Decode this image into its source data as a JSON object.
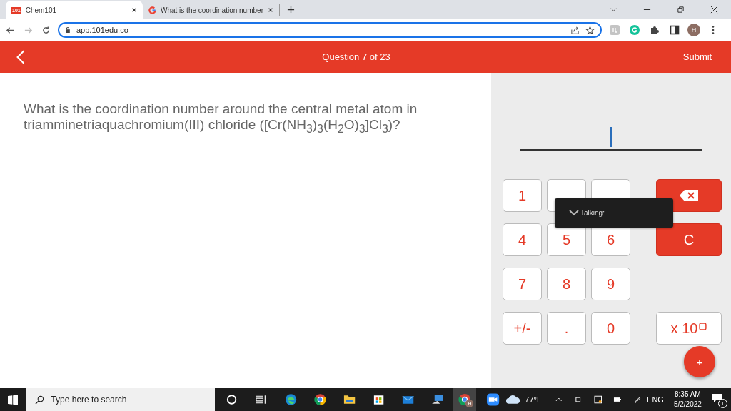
{
  "browser": {
    "tabs": [
      {
        "favicon_text": "101",
        "title": "Chem101",
        "selected": true
      },
      {
        "title": "What is the coordination number",
        "selected": false
      }
    ],
    "url": "app.101edu.co",
    "profile_initial": "H"
  },
  "header": {
    "title": "Question 7 of 23",
    "submit": "Submit"
  },
  "question": "What is the coordination number around the central metal atom in triamminetriaquachromium(III) chloride ([Cr(NH$_{3}$)$_{3}$(H$_{2}$O)$_{3}$]Cl$_{3}$)?",
  "keypad": {
    "digit_rows": [
      [
        {
          "label": "1"
        },
        {},
        {}
      ],
      [
        {
          "label": "4"
        },
        {
          "label": "5"
        },
        {
          "label": "6"
        }
      ],
      [
        {
          "label": "7"
        },
        {
          "label": "8"
        },
        {
          "label": "9"
        }
      ],
      [
        {
          "label": "+/-"
        },
        {
          "label": "."
        },
        {
          "label": "0"
        }
      ]
    ],
    "side_keys": [
      {
        "kind": "backspace"
      },
      {
        "kind": "clear",
        "label": "C"
      },
      {
        "kind": "exponent",
        "label": "x 10"
      }
    ],
    "fab": "+"
  },
  "tooltip": {
    "text": "Talking:"
  },
  "taskbar": {
    "search_placeholder": "Type here to search",
    "chrome_badge": "H",
    "weather": "77°F",
    "language": "ENG",
    "time": "8:35 AM",
    "date": "5/2/2022",
    "notifications": "1"
  }
}
